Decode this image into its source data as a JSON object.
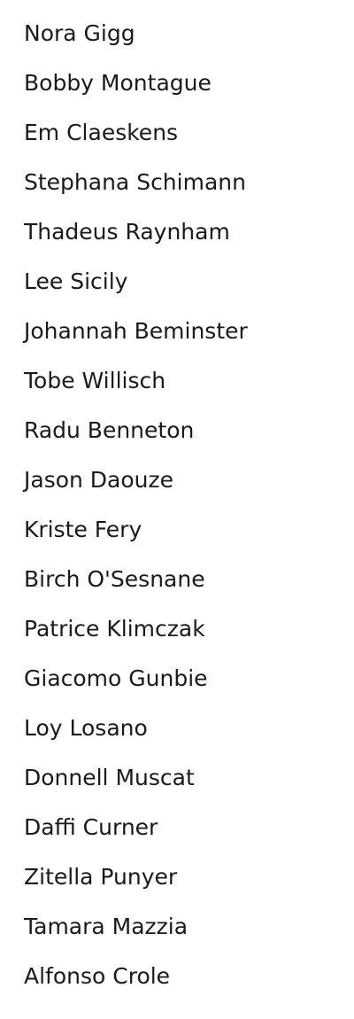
{
  "list": {
    "items": [
      "Nora Gigg",
      "Bobby Montague",
      "Em Claeskens",
      "Stephana Schimann",
      "Thadeus Raynham",
      "Lee Sicily",
      "Johannah Beminster",
      "Tobe Willisch",
      "Radu Benneton",
      "Jason Daouze",
      "Kriste Fery",
      "Birch O'Sesnane",
      "Patrice Klimczak",
      "Giacomo Gunbie",
      "Loy Losano",
      "Donnell Muscat",
      "Daffi Curner",
      "Zitella Punyer",
      "Tamara Mazzia",
      "Alfonso Crole"
    ]
  },
  "colors": {
    "background": "#ffffff",
    "text": "#1a1a1a"
  }
}
